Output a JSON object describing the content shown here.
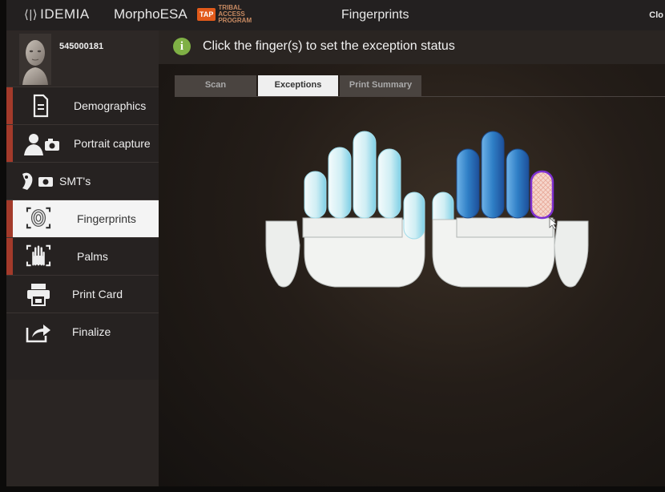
{
  "topbar": {
    "brand_idemia": "IDEMIA",
    "brand_idemia_mark": "⟨|⟩",
    "brand_product": "MorphoESA",
    "tap_badge": "TAP",
    "tap_words": [
      "TRIBAL",
      "ACCESS",
      "PROGRAM"
    ],
    "title": "Fingerprints",
    "close_label": "Clo"
  },
  "profile": {
    "subject_id": "545000181"
  },
  "sidebar": {
    "items": [
      {
        "label": "Demographics",
        "icon": "document-icon",
        "marker": true,
        "active": false
      },
      {
        "label": "Portrait capture",
        "icon": "portrait-camera-icon",
        "marker": true,
        "active": false
      },
      {
        "label": "SMT's",
        "icon": "tattoo-camera-icon",
        "marker": false,
        "active": false
      },
      {
        "label": "Fingerprints",
        "icon": "fingerprint-icon",
        "marker": true,
        "active": true
      },
      {
        "label": "Palms",
        "icon": "palm-icon",
        "marker": true,
        "active": false
      },
      {
        "label": "Print Card",
        "icon": "printer-icon",
        "marker": false,
        "active": false
      },
      {
        "label": "Finalize",
        "icon": "export-icon",
        "marker": false,
        "active": false
      }
    ]
  },
  "main": {
    "instruction": "Click the finger(s) to set the exception status",
    "info_icon_glyph": "i",
    "tabs": [
      {
        "label": "Scan",
        "active": false
      },
      {
        "label": "Exceptions",
        "active": true
      },
      {
        "label": "Print Summary",
        "active": false
      }
    ]
  },
  "colors": {
    "accent_red": "#a33a2a",
    "finger_unscanned": "#d8f1f5",
    "finger_scanned": "#2f7fc6",
    "finger_exception": "#f1c7bd",
    "exception_outline": "#7d2fd0"
  },
  "hands": {
    "left_hand": [
      "not-scanned",
      "not-scanned",
      "not-scanned",
      "not-scanned",
      "not-scanned"
    ],
    "right_hand": [
      "not-scanned",
      "scanned",
      "scanned",
      "scanned",
      "exception"
    ]
  }
}
